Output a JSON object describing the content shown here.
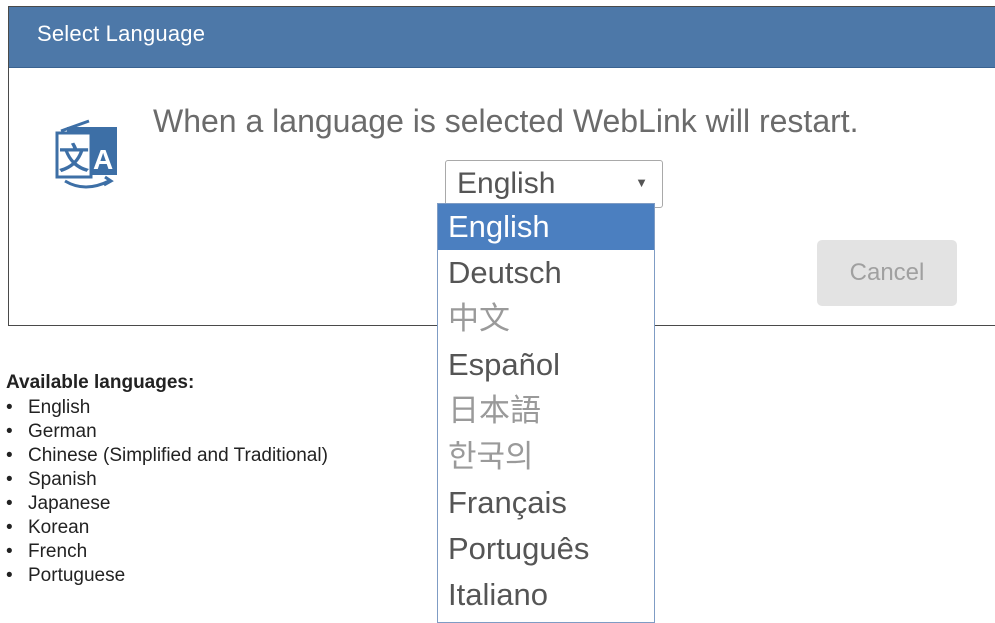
{
  "dialog": {
    "title": "Select Language",
    "message": "When a language is selected WebLink will restart.",
    "icon": "language-translate-icon",
    "select": {
      "value": "English",
      "arrow": "▼"
    },
    "cancel_label": "Cancel",
    "header_color": "#4d78a8"
  },
  "dropdown": {
    "options": [
      {
        "label": "English",
        "selected": true
      },
      {
        "label": "Deutsch"
      },
      {
        "label": "中文"
      },
      {
        "label": "Español"
      },
      {
        "label": "日本語"
      },
      {
        "label": "한국의"
      },
      {
        "label": "Français"
      },
      {
        "label": "Português"
      },
      {
        "label": "Italiano"
      }
    ],
    "selected_color": "#4b7fc0"
  },
  "available": {
    "title": "Available languages:",
    "items": [
      "English",
      "German",
      "Chinese (Simplified and Traditional)",
      "Spanish",
      "Japanese",
      "Korean",
      "French",
      "Portuguese"
    ]
  }
}
